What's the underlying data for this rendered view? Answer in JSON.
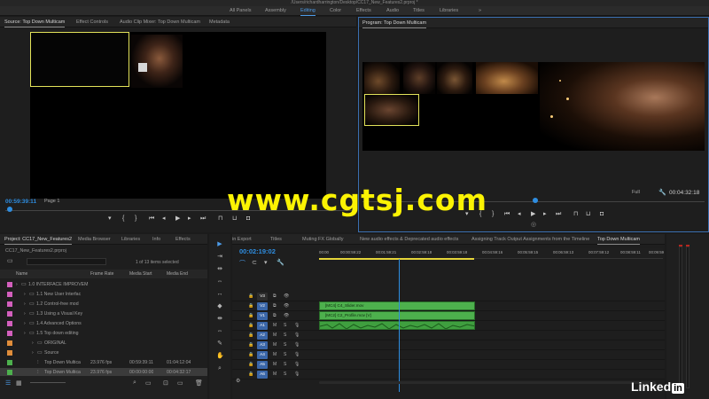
{
  "window": {
    "title": "/Users/richardharrington/Desktop/CC17_New_Features2.prproj *"
  },
  "workspaces": {
    "items": [
      "All Panels",
      "Assembly",
      "Editing",
      "Color",
      "Effects",
      "Audio",
      "Titles",
      "Libraries"
    ],
    "active": "Editing",
    "overflow": "»"
  },
  "source_panel": {
    "tabs": [
      "Source: Top Down Multicam",
      "Effect Controls",
      "Audio Clip Mixer: Top Down Multicam",
      "Metadata"
    ],
    "timecode": "00:59:39:11",
    "page": "Page 1"
  },
  "program_panel": {
    "tab": "Program: Top Down Multicam",
    "fit": "Full",
    "timecode_end": "00:04:32:18"
  },
  "project_panel": {
    "tabs": [
      "Project: CC17_New_Features2",
      "Media Browser",
      "Libraries",
      "Info",
      "Effects"
    ],
    "file": "CC17_New_Features2.prproj",
    "selection_count": "1 of 13 items selected",
    "columns": [
      "Name",
      "Frame Rate",
      "Media Start",
      "Media End"
    ],
    "rows": [
      {
        "name": "1.0 INTERFACE IMPROVEM",
        "color": "#d35fbd",
        "indent": 0,
        "frame_rate": "",
        "start": "",
        "end": ""
      },
      {
        "name": "1.1 New User Interfac",
        "color": "#d35fbd",
        "indent": 1,
        "frame_rate": "",
        "start": "",
        "end": ""
      },
      {
        "name": "1.2 Control-free mod",
        "color": "#d35fbd",
        "indent": 1,
        "frame_rate": "",
        "start": "",
        "end": ""
      },
      {
        "name": "1.3 Using a Visual Key",
        "color": "#d35fbd",
        "indent": 1,
        "frame_rate": "",
        "start": "",
        "end": ""
      },
      {
        "name": "1.4 Advanced Options",
        "color": "#d35fbd",
        "indent": 1,
        "frame_rate": "",
        "start": "",
        "end": ""
      },
      {
        "name": "1.5 Top down editing",
        "color": "#d35fbd",
        "indent": 1,
        "frame_rate": "",
        "start": "",
        "end": ""
      },
      {
        "name": "ORIGINAL",
        "color": "#e08d3a",
        "indent": 2,
        "frame_rate": "",
        "start": "",
        "end": ""
      },
      {
        "name": "Source",
        "color": "#e08d3a",
        "indent": 2,
        "frame_rate": "",
        "start": "",
        "end": ""
      },
      {
        "name": "Top Down Multica",
        "color": "#4db04d",
        "indent": 2,
        "frame_rate": "23.976 fps",
        "start": "00:59:39:11",
        "end": "01:04:12:04"
      },
      {
        "name": "Top Down Multica",
        "color": "#4db04d",
        "indent": 2,
        "frame_rate": "23.976 fps",
        "start": "00:00:00:00",
        "end": "00:04:32:17"
      }
    ]
  },
  "timeline": {
    "tabs": [
      "in Export",
      "Titles",
      "Muting FX Globally",
      "New audio effects & Deprecated audio effects",
      "Assigning Track Output Assignments from the Timeline",
      "Top Down Multicam"
    ],
    "timecode": "00:02:19:02",
    "ruler": [
      "00:00",
      "00:00:59:22",
      "00:01:59:21",
      "00:02:59:18",
      "00:03:59:18",
      "00:04:59:16",
      "00:05:59:15",
      "00:06:59:13",
      "00:07:59:12",
      "00:08:59:11",
      "00:09:59"
    ],
    "video_tracks": [
      "V3",
      "V2",
      "V1"
    ],
    "audio_tracks": [
      "A1",
      "A2",
      "A3",
      "A4",
      "A5",
      "A6"
    ],
    "clips": {
      "v2": "[MC4] C4_Slider.mov",
      "v1": "[MC2] C2_Profile.mov [V]"
    }
  },
  "watermark": "www.cgtsj.com",
  "branding": {
    "linkedin": "Linked",
    "in": "in"
  },
  "colors": {
    "accent": "#4c9be8",
    "clip_green": "#4db04d",
    "track_blue": "#3a66a8"
  }
}
